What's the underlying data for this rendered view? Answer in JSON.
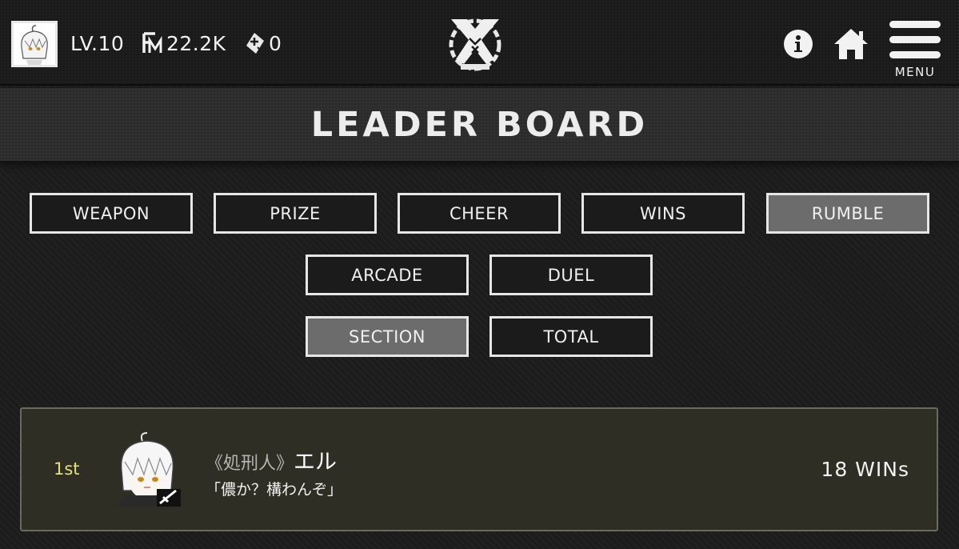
{
  "header": {
    "level": "LV.10",
    "fm_amount": "22.2K",
    "gem_count": "0",
    "menu_label": "MENU"
  },
  "page": {
    "title": "LEADER BOARD"
  },
  "filters": {
    "row1": [
      "WEAPON",
      "PRIZE",
      "CHEER",
      "WINS",
      "RUMBLE"
    ],
    "row2": [
      "ARCADE",
      "DUEL"
    ],
    "row3": [
      "SECTION",
      "TOTAL"
    ],
    "active": [
      "RUMBLE",
      "SECTION"
    ]
  },
  "leaderboard": {
    "entries": [
      {
        "rank": "1st",
        "title": "《処刑人》",
        "name": "エル",
        "quote": "「儂か？構わんぞ」",
        "score": "18 WINs"
      }
    ]
  },
  "colors": {
    "accent_rank": "#e6e07a",
    "active_button": "#6c6c6c",
    "card_bg": "#2e2e25"
  }
}
